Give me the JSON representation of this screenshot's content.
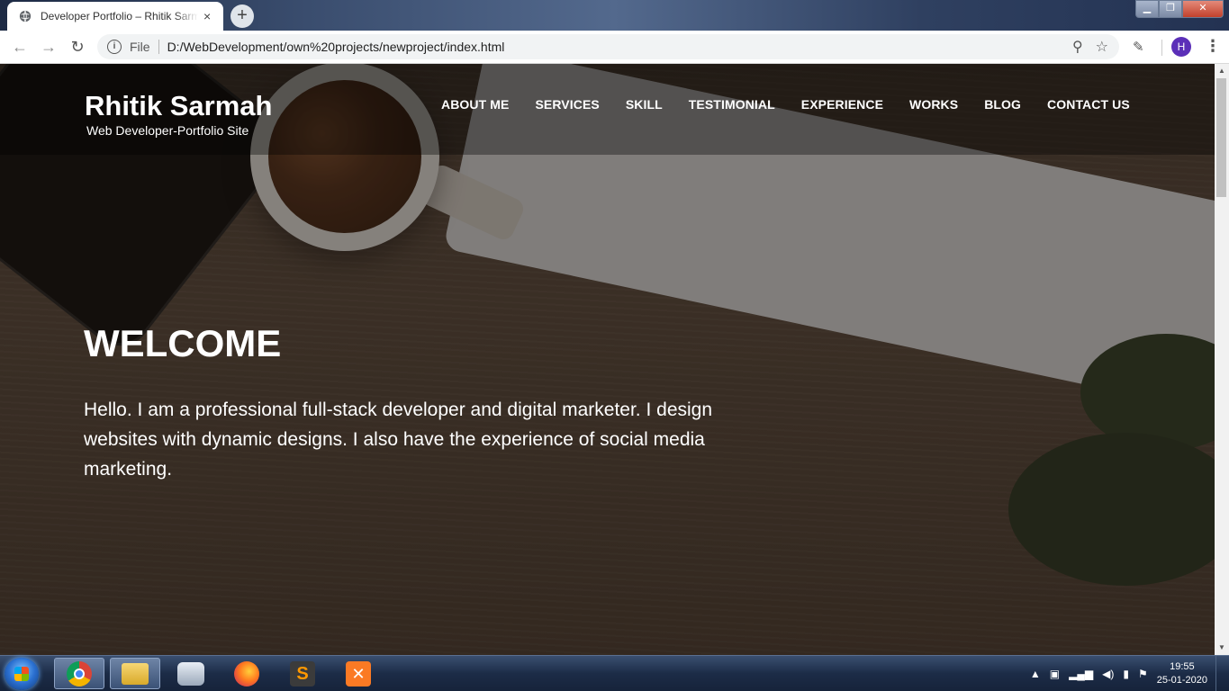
{
  "browser": {
    "tab_title": "Developer Portfolio – Rhitik Sarmah",
    "tab_close": "×",
    "new_tab": "+",
    "address_scheme": "File",
    "address_url": "D:/WebDevelopment/own%20projects/newproject/index.html",
    "profile_initial": "H",
    "icons": [
      "back-icon",
      "forward-icon",
      "reload-icon",
      "info-icon",
      "zoom-icon",
      "star-icon",
      "eyedropper-icon",
      "menu-icon"
    ],
    "window_controls": {
      "minimize": "▁",
      "maximize": "❐",
      "close": "✕"
    }
  },
  "site": {
    "brand_name": "Rhitik Sarmah",
    "brand_tagline": "Web Developer-Portfolio Site",
    "nav": [
      "ABOUT ME",
      "SERVICES",
      "SKILL",
      "TESTIMONIAL",
      "EXPERIENCE",
      "WORKS",
      "BLOG",
      "CONTACT US"
    ],
    "hero_title": "WELCOME",
    "hero_text": "Hello. I am a professional full-stack developer and digital marketer. I design websites with dynamic designs. I also have the experience of social media marketing."
  },
  "taskbar": {
    "apps": [
      "chrome-icon",
      "file-explorer-icon",
      "disk-utility-icon",
      "firefox-icon",
      "sublime-text-icon",
      "xampp-icon"
    ],
    "time": "19:55",
    "date": "25-01-2020"
  },
  "colors": {
    "avatar": "#5b2fb8",
    "nav_text": "#ffffff",
    "taskbar": "#1c2c47"
  }
}
